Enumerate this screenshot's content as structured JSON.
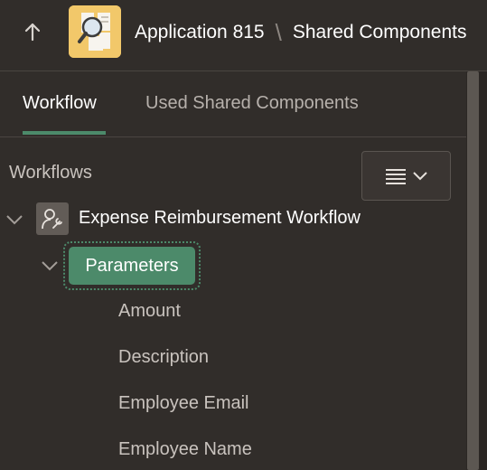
{
  "header": {
    "icons": {
      "up": "arrow-up-icon",
      "app": "application-icon"
    },
    "breadcrumb": {
      "app": "Application 815",
      "separator": "\\",
      "page": "Shared Components"
    }
  },
  "tabs": [
    {
      "label": "Workflow",
      "active": true
    },
    {
      "label": "Used Shared Components",
      "active": false
    }
  ],
  "tree": {
    "section_label": "Workflows",
    "menu_icons": [
      "hamburger-menu-icon",
      "chevron-down-icon"
    ],
    "workflow": {
      "label": "Expense Reimbursement Workflow",
      "icon": "user-wrench-icon"
    },
    "parameters": {
      "label": "Parameters",
      "items": [
        "Amount",
        "Description",
        "Employee Email",
        "Employee Name"
      ]
    }
  },
  "colors": {
    "background": "#312d2a",
    "accent": "#4c8a6a",
    "text": "#f1efed",
    "muted": "#c9c3be"
  }
}
